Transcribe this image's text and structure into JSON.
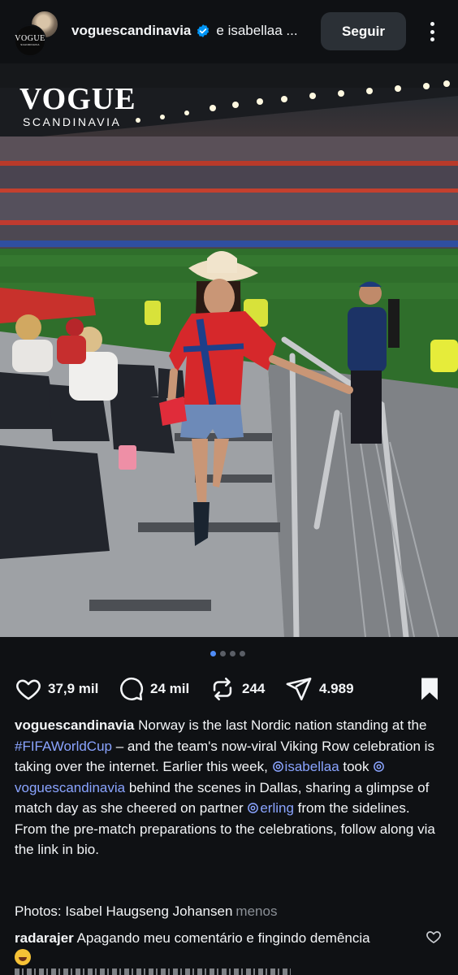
{
  "header": {
    "avatar_logo_text": "VOGUE",
    "avatar_logo_sub": "SCANDINAVIA",
    "author": "voguescandinavia",
    "coauthor": "e isabellaa ...",
    "follow_label": "Seguir",
    "more_icon": "more-vertical-icon"
  },
  "photo": {
    "watermark_title": "VOGUE",
    "watermark_sub": "SCANDINAVIA",
    "carousel_total": 4,
    "carousel_active": 1
  },
  "actions": {
    "likes": "37,9 mil",
    "comments": "24 mil",
    "reposts": "244",
    "shares": "4.989"
  },
  "caption": {
    "user": "voguescandinavia",
    "text_1": " Norway is the last Nordic nation standing at the ",
    "hashtag": "#FIFAWorldCup",
    "text_2": " – and the team's now-viral Viking Row celebration is taking over the internet. Earlier this week, ",
    "mention_1": "isabellaa",
    "text_3": " took ",
    "mention_2": "voguescandinavia",
    "text_4": " behind the scenes in Dallas, sharing a glimpse of match day as she cheered on partner ",
    "mention_3": "erling",
    "text_5": " from the sidelines. From the pre-match preparations to the celebrations, follow along via the link in bio.",
    "photos_credit": "Photos: Isabel Haugseng Johansen",
    "less_label": "menos"
  },
  "comment": {
    "user": "radarajer",
    "text": " Apagando meu comentário e fingindo demência"
  },
  "colors": {
    "background": "#0f1114",
    "link": "#8aa4ff",
    "verified": "#0095f6",
    "dot_active": "#4f8cf7"
  }
}
